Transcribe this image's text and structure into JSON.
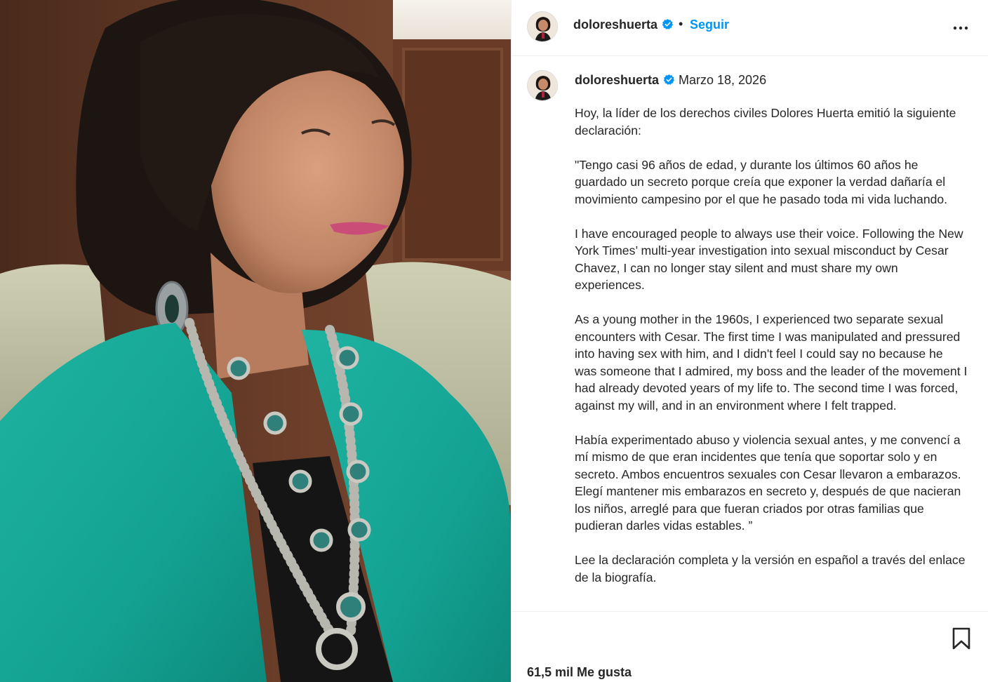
{
  "post": {
    "username": "doloreshuerta",
    "follow_label": "Seguir",
    "separator": "•",
    "date": "Marzo 18, 2026",
    "caption_paragraphs": [
      "Hoy, la líder de los derechos civiles Dolores Huerta emitió la siguiente declaración:",
      "\"Tengo casi 96 años de edad, y durante los últimos 60 años he guardado un secreto porque creía que exponer la verdad dañaría el movimiento campesino por el que he pasado toda mi vida luchando.",
      "I have encouraged people to always use their voice. Following the New York Times’ multi-year investigation into sexual misconduct by Cesar Chavez, I can no longer stay silent and must share my own experiences.",
      "As a young mother in the 1960s, I experienced two separate sexual encounters with Cesar. The first time I was manipulated and pressured into having sex with him, and I didn't feel I could say no because he was someone that I admired, my boss and the leader of the movement I had already devoted years of my life to. The second time I was forced, against my will, and in an environment where I felt trapped.",
      "Había experimentado abuso y violencia sexual antes, y me convencí a mí mismo de que eran incidentes que tenía que soportar solo y en secreto. Ambos encuentros sexuales con Cesar llevaron a embarazos. Elegí mantener mis embarazos en secreto y, después de que nacieran los niños, arreglé para que fueran criados por otras familias que pudieran darles vidas estables. ”",
      "Lee la declaración completa y la versión en español a través del enlace de la biografía."
    ],
    "likes": "61,5 mil Me gusta"
  },
  "icons": {
    "verified": "verified-badge-icon",
    "more": "more-options-icon",
    "bookmark": "bookmark-icon"
  },
  "colors": {
    "accent": "#0095f6",
    "text": "#262626",
    "border": "#efefef"
  }
}
